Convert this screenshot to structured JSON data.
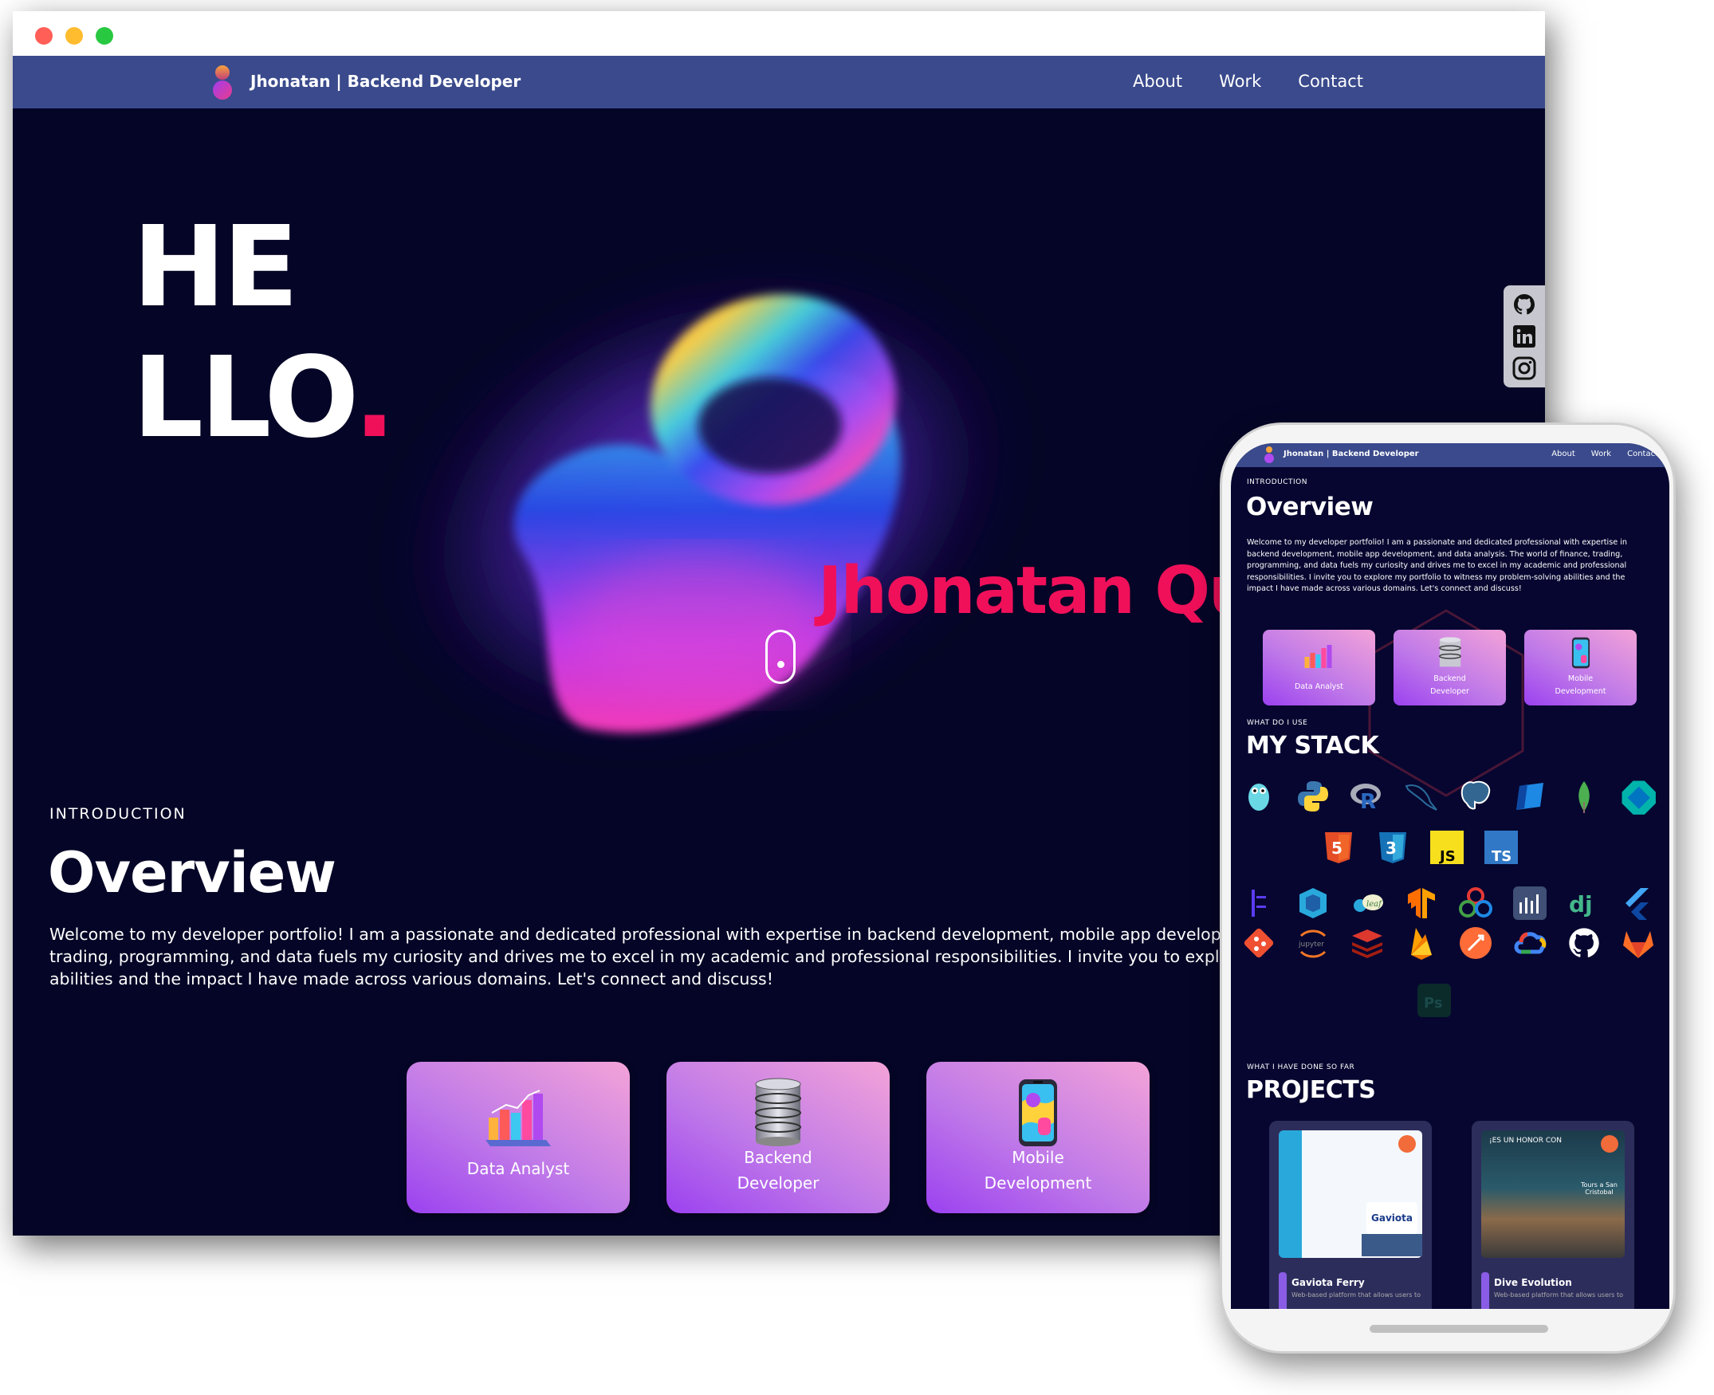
{
  "desktop": {
    "navbar": {
      "brand": "Jhonatan | Backend Developer",
      "links": [
        "About",
        "Work",
        "Contact"
      ]
    },
    "hero": {
      "hello_line1": "HE",
      "hello_line2": "LLO",
      "hello_dot": ".",
      "name": "Jhonatan Qu"
    },
    "social": [
      "github-icon",
      "linkedin-icon",
      "instagram-icon"
    ],
    "intro": {
      "label": "INTRODUCTION",
      "title": "Overview",
      "text_lines": [
        "Welcome to my developer portfolio! I am a passionate and dedicated professional with expertise in backend development, mobile app development, and",
        "trading, programming, and data fuels my curiosity and drives me to excel in my academic and professional responsibilities. I invite you to explore my port",
        "abilities and the impact I have made across various domains. Let's connect and discuss!"
      ]
    },
    "cards": [
      {
        "line1": "Data Analyst",
        "line2": ""
      },
      {
        "line1": "Backend",
        "line2": "Developer"
      },
      {
        "line1": "Mobile",
        "line2": "Development"
      }
    ]
  },
  "mobile": {
    "navbar": {
      "brand": "Jhonatan | Backend Developer",
      "links": [
        "About",
        "Work",
        "Contact"
      ]
    },
    "intro": {
      "label": "INTRODUCTION",
      "title": "Overview",
      "text": "Welcome to my developer portfolio! I am a passionate and dedicated professional with expertise in backend development, mobile app development, and data analysis. The world of finance, trading, programming, and data fuels my curiosity and drives me to excel in my academic and professional responsibilities. I invite you to explore my portfolio to witness my problem-solving abilities and the impact I have made across various domains. Let's connect and discuss!"
    },
    "cards": [
      {
        "line1": "Data Analyst",
        "line2": ""
      },
      {
        "line1": "Backend",
        "line2": "Developer"
      },
      {
        "line1": "Mobile",
        "line2": "Development"
      }
    ],
    "stack": {
      "label": "WHAT DO I USE",
      "title": "MY STACK",
      "icons_row1": [
        "go-icon",
        "python-icon",
        "r-icon",
        "mysql-icon",
        "postgresql-icon",
        "azure-sql-icon",
        "mongodb-icon",
        "dart-icon"
      ],
      "icons_row2": [
        "html5-icon",
        "css3-icon",
        "javascript-icon",
        "typescript-icon"
      ],
      "icons_row3": [
        "pycharm-icon",
        "nestjs-icon",
        "leaflet-icon",
        "tensorflow-icon",
        "kubeflow-icon",
        "plotly-icon",
        "django-icon",
        "flutter-icon"
      ],
      "icons_row4": [
        "git-icon",
        "jupyter-icon",
        "redis-icon",
        "firebase-icon",
        "postman-icon",
        "google-cloud-icon",
        "github-icon",
        "gitlab-icon"
      ],
      "icons_row5": [
        "photoshop-icon"
      ],
      "js_label": "JS",
      "ts_label": "TS",
      "dj_label": "dj",
      "ps_label": "Ps",
      "jupyter_label": "jupyter"
    },
    "projects": {
      "label": "WHAT I HAVE DONE SO FAR",
      "title": "PROJECTS",
      "items": [
        {
          "name": "Gaviota Ferry",
          "desc": "Web-based platform that allows users to",
          "shot_text": "Gaviota"
        },
        {
          "name": "Dive Evolution",
          "desc": "Web-based platform that allows users to",
          "shot_text": "¡ES UN HONOR CON",
          "shot_text2": "Tours a San Cristobal"
        }
      ]
    }
  },
  "colors": {
    "background": "#050527",
    "navbar": "#3a4a8c",
    "accent_pink": "#f0105a",
    "card_gradient": [
      "#f3a3d8",
      "#9b41f0"
    ]
  }
}
